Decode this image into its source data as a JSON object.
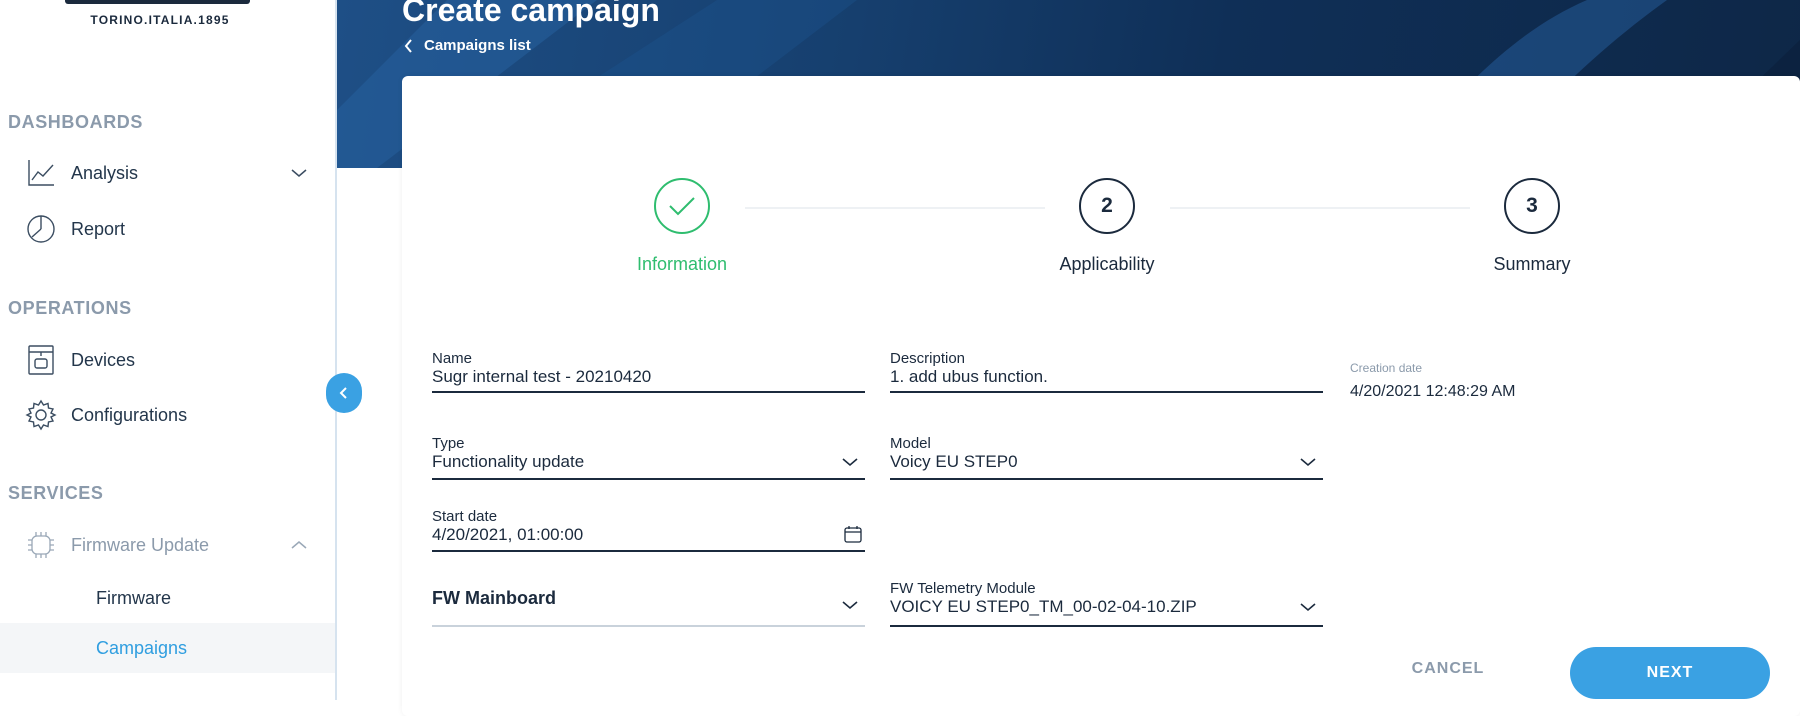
{
  "brand": {
    "tagline": "TORINO.ITALIA.1895"
  },
  "sidebar": {
    "sections": [
      {
        "title": "DASHBOARDS",
        "items": [
          {
            "label": "Analysis",
            "icon": "line-chart-icon",
            "expandable": true
          },
          {
            "label": "Report",
            "icon": "pie-chart-icon"
          }
        ]
      },
      {
        "title": "OPERATIONS",
        "items": [
          {
            "label": "Devices",
            "icon": "coffee-machine-icon"
          },
          {
            "label": "Configurations",
            "icon": "gear-icon"
          }
        ]
      },
      {
        "title": "SERVICES",
        "items": [
          {
            "label": "Firmware Update",
            "icon": "chip-icon",
            "expanded": true,
            "sub_items": [
              {
                "label": "Firmware"
              },
              {
                "label": "Campaigns",
                "active": true
              }
            ]
          }
        ]
      }
    ]
  },
  "header": {
    "title": "Create campaign",
    "back_label": "Campaigns list"
  },
  "stepper": {
    "steps": [
      {
        "number": "",
        "label": "Information",
        "state": "done"
      },
      {
        "number": "2",
        "label": "Applicability",
        "state": "pending"
      },
      {
        "number": "3",
        "label": "Summary",
        "state": "pending"
      }
    ],
    "done_color": "#2fbd6f"
  },
  "form": {
    "name": {
      "label": "Name",
      "value": "Sugr internal test - 20210420"
    },
    "description": {
      "label": "Description",
      "value": "1. add ubus function."
    },
    "creation": {
      "label": "Creation date",
      "value": "4/20/2021 12:48:29 AM"
    },
    "type": {
      "label": "Type",
      "value": "Functionality update"
    },
    "model": {
      "label": "Model",
      "value": "Voicy EU STEP0"
    },
    "start_date": {
      "label": "Start date",
      "value": "4/20/2021, 01:00:00"
    },
    "fw_mainboard": {
      "label": "FW Mainboard",
      "value": ""
    },
    "fw_telemetry": {
      "label": "FW Telemetry Module",
      "value": "VOICY EU STEP0_TM_00-02-04-10.ZIP"
    }
  },
  "actions": {
    "cancel_label": "CANCEL",
    "next_label": "NEXT"
  },
  "colors": {
    "accent": "#3aa1e3",
    "success": "#2fbd6f",
    "navy": "#1b2a3d",
    "muted": "#8b9aab"
  }
}
